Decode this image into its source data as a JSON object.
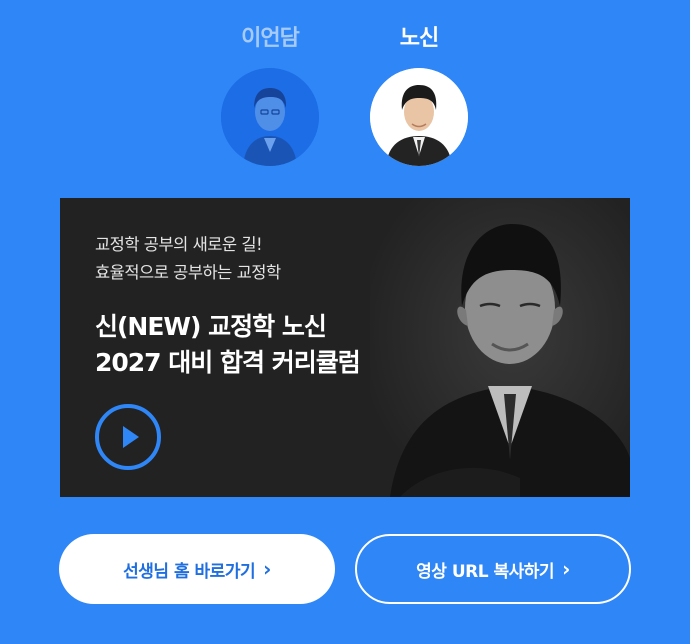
{
  "teachers": [
    {
      "name": "이언담",
      "selected": false
    },
    {
      "name": "노신",
      "selected": true
    }
  ],
  "banner": {
    "subtitle_line1": "교정학 공부의 새로운 길!",
    "subtitle_line2": "효율적으로 공부하는 교정학",
    "title_line1": "신(NEW) 교정학 노신",
    "title_line2": "2027 대비 합격 커리큘럼"
  },
  "buttons": {
    "home_label": "선생님 홈 바로가기",
    "copy_label": "영상 URL 복사하기",
    "chevron": "›"
  },
  "colors": {
    "background": "#2f86f6",
    "banner": "#222222",
    "accent": "#2f86f6",
    "inactive_name": "#a5cafb"
  },
  "icons": {
    "play": "play-icon",
    "chevron": "chevron-right-icon"
  }
}
